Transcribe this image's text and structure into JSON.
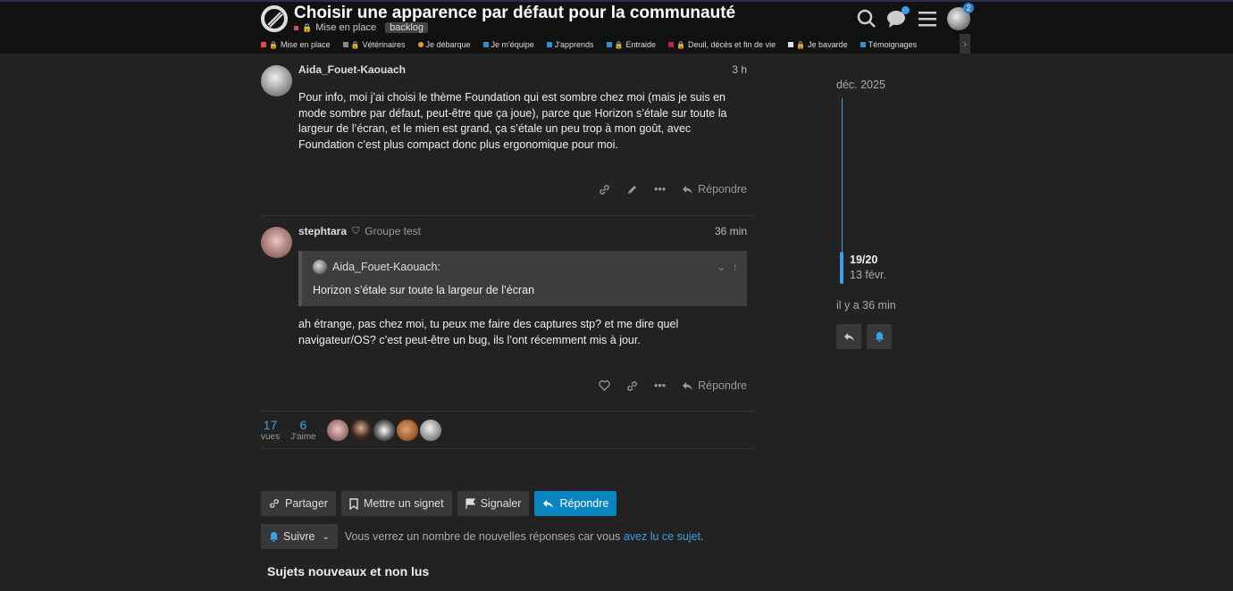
{
  "header": {
    "title": "Choisir une apparence par défaut pour la communauté",
    "category": "Mise en place",
    "tag": "backlog",
    "notification_count": "2"
  },
  "nav": {
    "items": [
      {
        "label": "Mise en place",
        "color": "#e04a4a"
      },
      {
        "label": "Vétérinaires",
        "color": "#888888"
      },
      {
        "label": "Je débarque",
        "color": "#f0a020"
      },
      {
        "label": "Je m'équipe",
        "color": "#2a8fd8"
      },
      {
        "label": "J'apprends",
        "color": "#2a8fd8"
      },
      {
        "label": "Entraide",
        "color": "#2a8fd8"
      },
      {
        "label": "Deuil, décès et fin de vie",
        "color": "#c02040"
      },
      {
        "label": "Je bavarde",
        "color": "#e0e0e0"
      },
      {
        "label": "Témoignages",
        "color": "#2a8fd8"
      }
    ]
  },
  "posts": [
    {
      "username": "Aida_Fouet-Kaouach",
      "time": "3 h",
      "body": "Pour info, moi j’ai choisi le thème Foundation qui est sombre chez moi (mais je suis en mode sombre par défaut, peut-être que ça joue), parce que Horizon s’étale sur toute la largeur de l’écran, et le mien est grand, ça s’étale un peu trop à mon goût, avec Foundation c’est plus compact donc plus ergonomique pour moi.",
      "reply_label": "Répondre"
    },
    {
      "username": "stephtara",
      "group": "Groupe test",
      "time": "36 min",
      "quote_author": "Aida_Fouet-Kaouach:",
      "quote_text": "Horizon s’étale sur toute la largeur de l’écran",
      "body": "ah étrange, pas chez moi, tu peux me faire des captures stp? et me dire quel navigateur/OS? c’est peut-être un bug, ils l’ont récemment mis à jour.",
      "reply_label": "Répondre"
    }
  ],
  "stats": {
    "views": "17",
    "views_label": "vues",
    "likes": "6",
    "likes_label": "J'aime"
  },
  "buttons": {
    "share": "Partager",
    "bookmark": "Mettre un signet",
    "flag": "Signaler",
    "reply": "Répondre",
    "follow": "Suivre"
  },
  "follow_msg": {
    "text": "Vous verrez un nombre de nouvelles réponses car vous ",
    "link": "avez lu ce sujet",
    "end": "."
  },
  "section_title": "Sujets nouveaux et non lus",
  "timeline": {
    "top_date": "déc. 2025",
    "position": "19/20",
    "position_date": "13 févr.",
    "ago": "il y a 36 min"
  }
}
